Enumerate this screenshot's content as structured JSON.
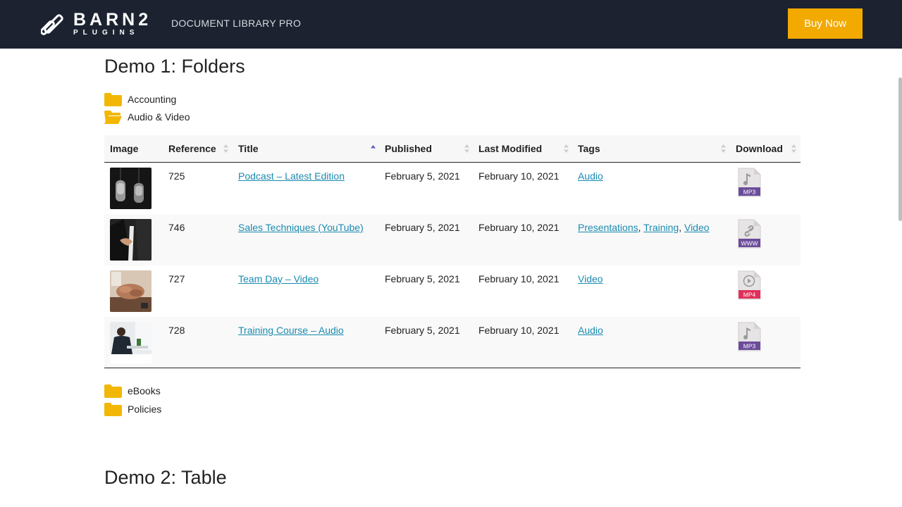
{
  "header": {
    "brand_main": "BARN2",
    "brand_sub": "PLUGINS",
    "product": "DOCUMENT LIBRARY PRO",
    "buy_label": "Buy Now"
  },
  "demo1": {
    "title": "Demo 1: Folders",
    "folders_above": [
      {
        "label": "Accounting",
        "state": "closed"
      },
      {
        "label": "Audio & Video",
        "state": "open"
      }
    ],
    "folders_below": [
      {
        "label": "eBooks",
        "state": "closed"
      },
      {
        "label": "Policies",
        "state": "closed"
      }
    ]
  },
  "table": {
    "columns": [
      "Image",
      "Reference",
      "Title",
      "Published",
      "Last Modified",
      "Tags",
      "Download"
    ],
    "sorted_column": "Title",
    "rows": [
      {
        "reference": "725",
        "title": "Podcast – Latest Edition",
        "published": "February 5, 2021",
        "modified": "February 10, 2021",
        "tags": [
          "Audio"
        ],
        "download": "MP3",
        "thumb": "microphones"
      },
      {
        "reference": "746",
        "title": "Sales Techniques (YouTube)",
        "published": "February 5, 2021",
        "modified": "February 10, 2021",
        "tags": [
          "Presentations",
          "Training",
          "Video"
        ],
        "download": "WWW",
        "thumb": "handshake"
      },
      {
        "reference": "727",
        "title": "Team Day – Video",
        "published": "February 5, 2021",
        "modified": "February 10, 2021",
        "tags": [
          "Video"
        ],
        "download": "MP4",
        "thumb": "team-hands"
      },
      {
        "reference": "728",
        "title": "Training Course – Audio",
        "published": "February 5, 2021",
        "modified": "February 10, 2021",
        "tags": [
          "Audio"
        ],
        "download": "MP3",
        "thumb": "office-desk"
      }
    ]
  },
  "demo2": {
    "title": "Demo 2: Table"
  },
  "colors": {
    "header_bg": "#1c2230",
    "accent": "#f2a900",
    "link": "#1a8bb0",
    "folder": "#f2b705",
    "mp3": "#6b4c9a",
    "www": "#6b4c9a",
    "mp4": "#e0305a"
  }
}
